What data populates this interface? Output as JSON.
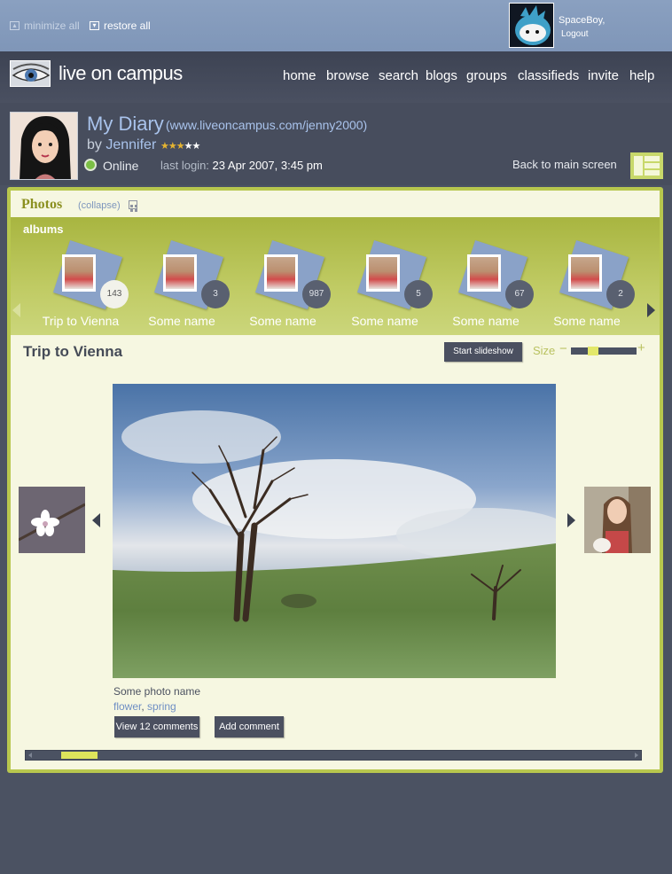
{
  "window": {
    "minimize_all": "minimize all",
    "restore_all": "restore all"
  },
  "user": {
    "name": "SpaceBoy,",
    "logout": "Logout"
  },
  "brand": {
    "name": "live on campus"
  },
  "nav": {
    "items": [
      "home",
      "browse",
      "search",
      "blogs",
      "groups",
      "classifieds",
      "invite",
      "help"
    ]
  },
  "profile": {
    "title": "My Diary",
    "url": "(www.liveoncampus.com/jenny2000)",
    "by": "by",
    "author": "Jennifer",
    "rating": 3,
    "rating_max": 5,
    "status": "Online",
    "last_login_label": "last login:",
    "last_login_value": "23 Apr 2007, 3:45 pm",
    "back_link": "Back to main screen"
  },
  "photos": {
    "section_title": "Photos",
    "collapse": "(collapse)",
    "albums_label": "albums",
    "albums": [
      {
        "name": "Trip to Vienna",
        "count": "143",
        "active": true
      },
      {
        "name": "Some name",
        "count": "3",
        "active": false
      },
      {
        "name": "Some name",
        "count": "987",
        "active": false
      },
      {
        "name": "Some name",
        "count": "5",
        "active": false
      },
      {
        "name": "Some name",
        "count": "67",
        "active": false
      },
      {
        "name": "Some name",
        "count": "2",
        "active": false
      }
    ],
    "current_album": "Trip to Vienna",
    "slideshow_button": "Start slideshow",
    "size_label": "Size",
    "size_minus": "−",
    "size_plus": "+",
    "photo_name": "Some photo name",
    "tags": [
      "flower",
      "spring"
    ],
    "view_comments": "View 12 comments",
    "add_comment": "Add comment"
  },
  "colors": {
    "accent_green": "#b8c74e",
    "link_blue": "#a9c3ec",
    "panel_bg": "#f6f7e1",
    "page_bg": "#4b5262"
  }
}
